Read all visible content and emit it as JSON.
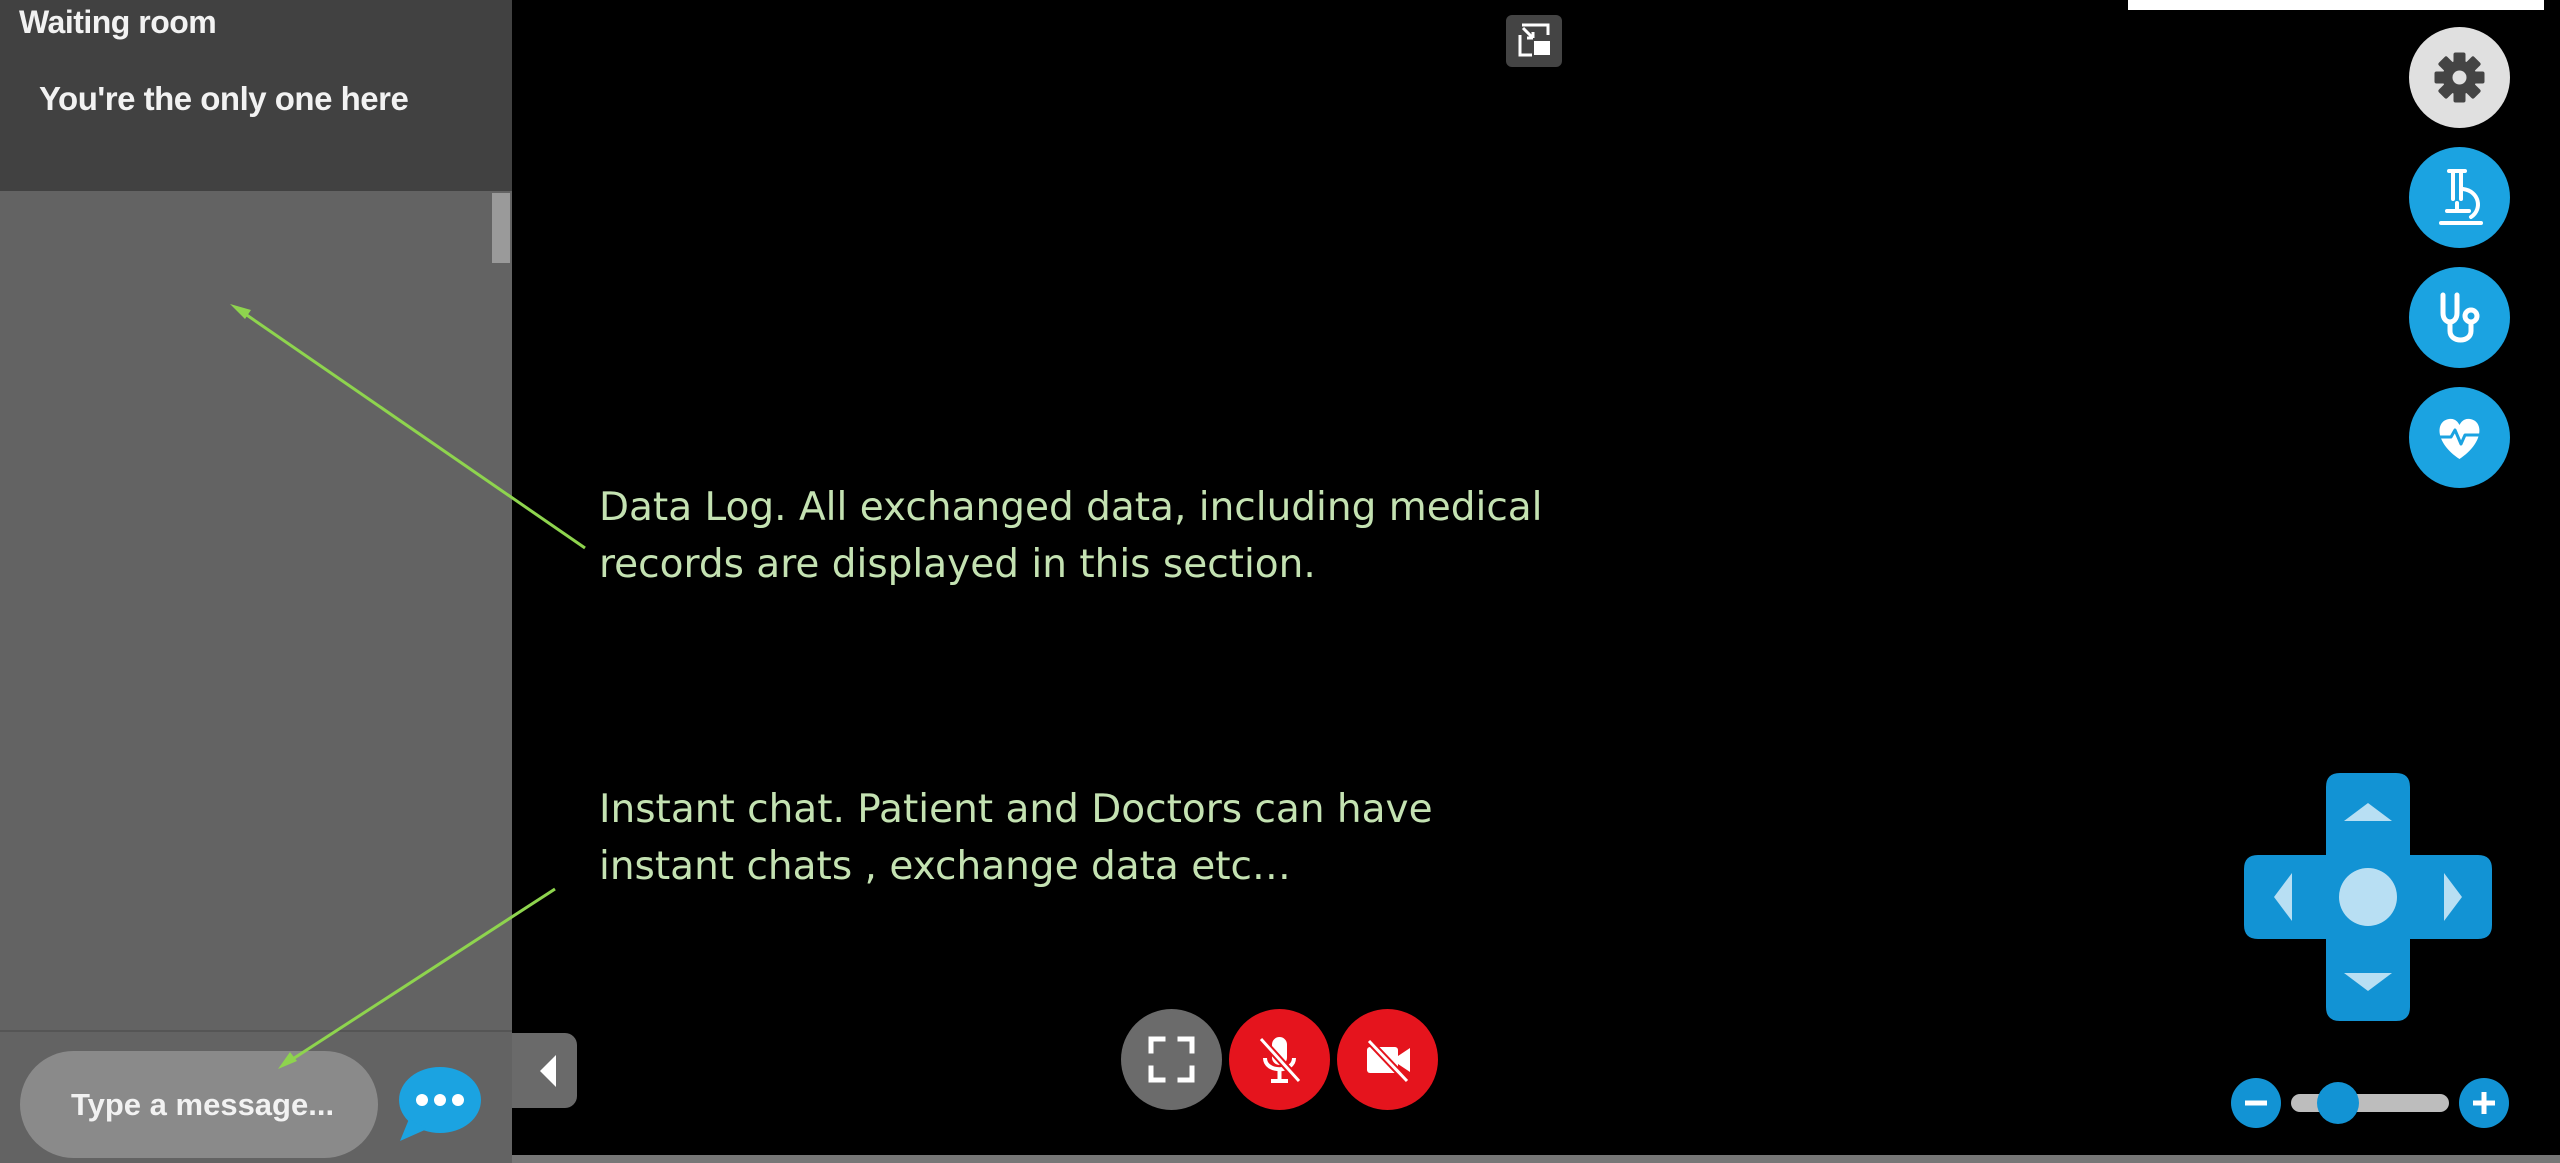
{
  "sidebar": {
    "title": "Waiting room",
    "status": "You're the only one here",
    "chat_placeholder": "Type a message..."
  },
  "annotations": {
    "data_log": "Data Log. All exchanged data, including medical\nrecords are displayed in this section.",
    "instant_chat": "Instant chat. Patient and Doctors can have\ninstant chats , exchange data etc…"
  },
  "icons": {
    "settings": "gear-icon",
    "microscope": "microscope-icon",
    "stethoscope": "stethoscope-icon",
    "vitals": "heart-pulse-icon",
    "fullscreen": "fullscreen-icon",
    "mic": "mic-off-icon",
    "camera": "camera-off-icon",
    "pip": "picture-in-picture-icon",
    "send": "chat-bubble-icon"
  },
  "camera_controls": {
    "zoom_level": 0.3
  },
  "colors": {
    "accent": "#1ba3e1",
    "dpad": "#1293d4",
    "danger": "#e5141d",
    "annotation": "#c4e2b2",
    "arrow": "#8ed44e"
  }
}
